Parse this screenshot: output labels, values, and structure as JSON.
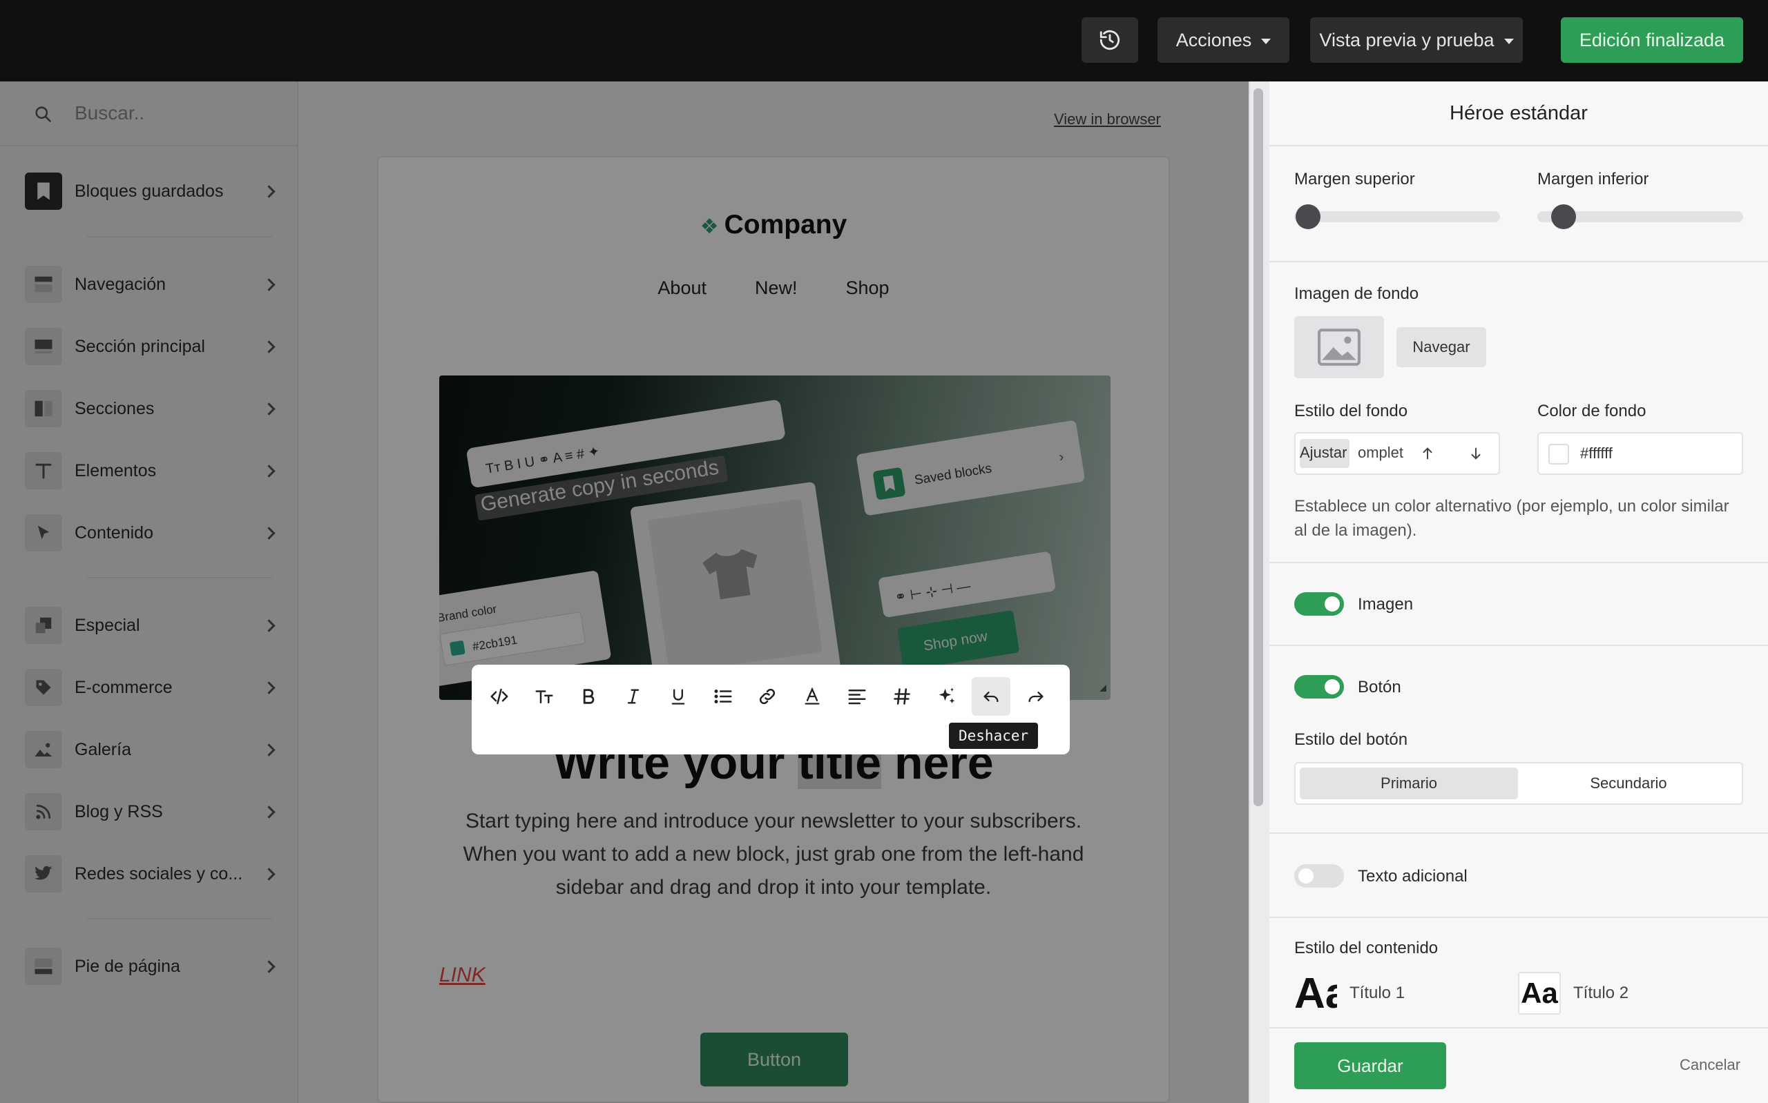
{
  "topbar": {
    "actions_label": "Acciones",
    "preview_label": "Vista previa y prueba",
    "done_label": "Edición finalizada"
  },
  "sidebar": {
    "search_placeholder": "Buscar..",
    "items": [
      {
        "label": "Bloques guardados",
        "icon": "bookmark-icon"
      },
      {
        "label": "Navegación",
        "icon": "navigation-block-icon"
      },
      {
        "label": "Sección principal",
        "icon": "hero-block-icon"
      },
      {
        "label": "Secciones",
        "icon": "columns-icon"
      },
      {
        "label": "Elementos",
        "icon": "text-icon"
      },
      {
        "label": "Contenido",
        "icon": "cursor-icon"
      },
      {
        "label": "Especial",
        "icon": "special-icon"
      },
      {
        "label": "E-commerce",
        "icon": "tag-icon"
      },
      {
        "label": "Galería",
        "icon": "image-icon"
      },
      {
        "label": "Blog y RSS",
        "icon": "rss-icon"
      },
      {
        "label": "Redes sociales y co...",
        "icon": "twitter-icon"
      },
      {
        "label": "Pie de página",
        "icon": "footer-block-icon"
      }
    ]
  },
  "canvas": {
    "view_in_browser": "View in browser",
    "company": "Company",
    "nav": [
      "About",
      "New!",
      "Shop"
    ],
    "hero_image": {
      "toolbar_text": "Generate copy in seconds",
      "saved_blocks": "Saved blocks",
      "brand_color_label": "Brand color",
      "brand_color_value": "#2cb191",
      "shop_now": "Shop now"
    },
    "title_before": "Write your ",
    "title_highlight": "title",
    "title_after": " here",
    "body": "Start typing here and introduce your newsletter to your subscribers. When you want to add a new block, just grab one from the left-hand sidebar and drag and drop it into your template.",
    "link": "LINK",
    "button": "Button"
  },
  "rich_text_toolbar": {
    "tooltip": "Deshacer",
    "tools": [
      "code-icon",
      "text-size-icon",
      "bold-icon",
      "italic-icon",
      "underline-icon",
      "list-icon",
      "link-icon",
      "text-color-icon",
      "align-icon",
      "hash-icon",
      "ai-sparkle-icon",
      "undo-icon",
      "redo-icon"
    ]
  },
  "panel": {
    "title": "Héroe estándar",
    "margin_top_label": "Margen superior",
    "margin_bottom_label": "Margen inferior",
    "margin_top_value": 0,
    "margin_bottom_value": 0.05,
    "bg_image_label": "Imagen de fondo",
    "browse_label": "Navegar",
    "bg_style_label": "Estilo del fondo",
    "bg_style_value": "Ajustar",
    "bg_style_overflow": "omplet",
    "bg_color_label": "Color de fondo",
    "bg_color_value": "#ffffff",
    "bg_note": "Establece un color alternativo (por ejemplo, un color similar al de la imagen).",
    "image_toggle_label": "Imagen",
    "image_toggle_on": true,
    "button_toggle_label": "Botón",
    "button_toggle_on": true,
    "button_style_label": "Estilo del botón",
    "button_style_primary": "Primario",
    "button_style_secondary": "Secundario",
    "extra_text_label": "Texto adicional",
    "extra_text_on": false,
    "content_style_label": "Estilo del contenido",
    "sample_glyph": "Aa",
    "heading1_label": "Título 1",
    "heading2_label": "Título 2",
    "save_label": "Guardar",
    "cancel_label": "Cancelar"
  },
  "colors": {
    "accent_green": "#2e9d55",
    "topbar": "#101010",
    "link_red": "#e14848"
  }
}
